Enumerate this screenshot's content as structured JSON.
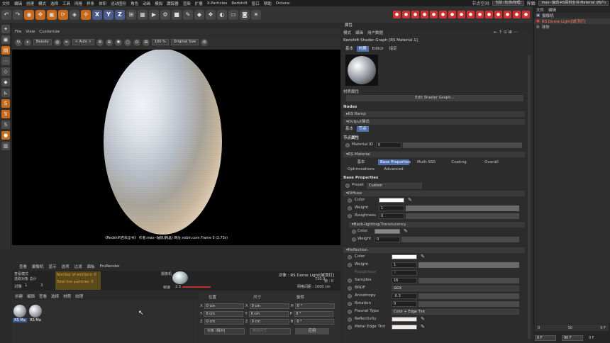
{
  "menubar": {
    "items": [
      "文件",
      "编辑",
      "创建",
      "模式",
      "选择",
      "工具",
      "网格",
      "样条",
      "体积",
      "运动图形",
      "角色",
      "动画",
      "模拟",
      "跟踪器",
      "渲染",
      "扩展",
      "X-Particles",
      "Redshift",
      "窗口",
      "帮助",
      "Octane"
    ],
    "node_space_label": "节点空间:",
    "node_space_value": "当前 (标准/物理)",
    "interface_label": "界面:",
    "interface_value": "max--轴现-RS百科全书-Material (用户)"
  },
  "viewport": {
    "menu": [
      "File",
      "View",
      "Customize"
    ],
    "toolbar": {
      "camera": "Beauty",
      "layer": "< Auto >",
      "zoom": "100 %",
      "display": "Original Size"
    },
    "caption": "《Redshift百科全书》 作者:max--轴现(韩晶) 网址:vobin.com  Frame 0 (2.73s)"
  },
  "timeline_info": {
    "mode": "查看模式",
    "selected": "选取对象 总计",
    "objects_label": "对象",
    "objects_value": "1",
    "count_value": "3",
    "emitters": "Number of emitters: 0",
    "particles": "Total live particles: 0",
    "cam_label": "摄像机",
    "speed_label": "帧速",
    "speed_value": "2.3",
    "object_title": "对象 : RS Dome Light[城顶灯]",
    "frame_value": "帧 : 0",
    "grid_label": "网格间距 : 1000 cm",
    "fps_value": "720.0"
  },
  "bottom_tabs": [
    "查看",
    "摄像机",
    "显示",
    "选项",
    "过滤",
    "面板",
    "ProRender"
  ],
  "material_manager": {
    "menu": [
      "创建",
      "编辑",
      "查看",
      "选择",
      "材质",
      "纹理"
    ],
    "materials": [
      {
        "label": "RS Ma"
      },
      {
        "label": "RS Ma"
      }
    ]
  },
  "coords": {
    "headers": [
      "位置",
      "尺寸",
      "旋转"
    ],
    "rows": [
      {
        "axis": "X",
        "pos": "0 cm",
        "size_axis": "X",
        "size": "0 cm",
        "rot_axis": "H",
        "rot": "0 °"
      },
      {
        "axis": "Y",
        "pos": "0 cm",
        "size_axis": "Y",
        "size": "0 cm",
        "rot_axis": "P",
        "rot": "0 °"
      },
      {
        "axis": "Z",
        "pos": "0 cm",
        "size_axis": "Z",
        "size": "0 cm",
        "rot_axis": "B",
        "rot": "0 °"
      }
    ],
    "mode": "对象 (相对)",
    "size_mode": "绝对尺寸",
    "apply": "应用"
  },
  "attributes": {
    "panel_title": "属性",
    "menu": [
      "模式",
      "编辑",
      "用户数据"
    ],
    "title": "Redshift Shader Graph [RS Material.1]",
    "tabs": [
      "基本",
      "材质",
      "Editor",
      "指定"
    ],
    "material_attr": "材质属性",
    "edit_graph": "Edit Shader Graph...",
    "nodes": "Nodes",
    "rs_ramp": "▸RS Ramp",
    "output": "▾Output输出",
    "out_tabs": [
      "基本",
      "节点"
    ],
    "node_attr": "节点属性",
    "material_id_label": "Material ID",
    "material_id_value": "0",
    "rs_material": "▾RS Material",
    "mat_tabs": [
      "基本",
      "Base Properties",
      "Multi-SSS",
      "Coating",
      "Overall",
      "Optimizations",
      "Advanced"
    ],
    "base_props": "Base Properties",
    "preset_label": "Preset",
    "preset_value": "Custom",
    "diffuse": "▾Diffuse",
    "color_label": "Color",
    "weight_label": "Weight",
    "weight_value": "1",
    "roughness_label": "Roughness",
    "roughness_value": "0",
    "backlight": "▾Back-lighting/Translucency",
    "bl_color_label": "Color",
    "bl_weight_label": "Weight",
    "bl_weight_value": "0",
    "reflection": "▾Reflection",
    "r_color_label": "Color",
    "r_weight_label": "Weight",
    "r_weight_value": "1",
    "r_rough_label": "Roughness",
    "r_rough_value": "0",
    "samples_label": "Samples",
    "samples_value": "16",
    "brdf_label": "BRDF",
    "brdf_value": "GGX",
    "aniso_label": "Anisotropy",
    "aniso_value": "-0.3",
    "rotation_label": "Rotation",
    "rotation_value": "0",
    "fresnel_label": "Fresnel Type",
    "fresnel_value": "Color + Edge Tint",
    "reflectivity_label": "Reflectivity",
    "edge_tint_label": "Metal Edge Tint"
  },
  "object_manager": {
    "menu": [
      "文件",
      "编辑"
    ],
    "objects": [
      {
        "name": "摄像机"
      },
      {
        "name": "RS Dome Light[城顶灯]"
      },
      {
        "name": "球体"
      }
    ]
  },
  "timeline_bottom": {
    "ticks": [
      "0",
      "50",
      "0 F"
    ],
    "start": "0 F",
    "end": "90 F",
    "current": "0 F"
  },
  "colors": {
    "accent": "#4e6fae",
    "orange": "#c86a1a",
    "red_icons": "#d03030"
  }
}
